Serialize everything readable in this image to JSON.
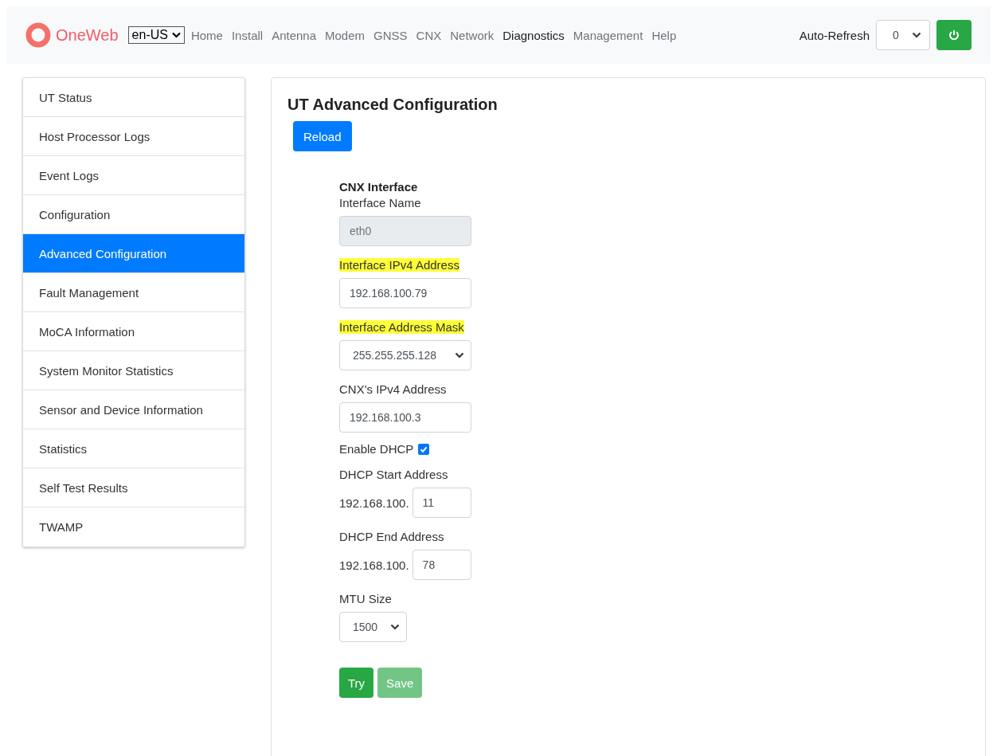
{
  "navbar": {
    "brand": "OneWeb",
    "language": "en-US",
    "links": [
      {
        "label": "Home",
        "selected": false
      },
      {
        "label": "Install",
        "selected": false
      },
      {
        "label": "Antenna",
        "selected": false
      },
      {
        "label": "Modem",
        "selected": false
      },
      {
        "label": "GNSS",
        "selected": false
      },
      {
        "label": "CNX",
        "selected": false
      },
      {
        "label": "Network",
        "selected": false
      },
      {
        "label": "Diagnostics",
        "selected": true
      },
      {
        "label": "Management",
        "selected": false
      },
      {
        "label": "Help",
        "selected": false
      }
    ],
    "auto_refresh": {
      "label": "Auto-Refresh",
      "value": "0"
    }
  },
  "sidebar": {
    "items": [
      {
        "label": "UT Status",
        "selected": false
      },
      {
        "label": "Host Processor Logs",
        "selected": false
      },
      {
        "label": "Event Logs",
        "selected": false
      },
      {
        "label": "Configuration",
        "selected": false
      },
      {
        "label": "Advanced Configuration",
        "selected": true
      },
      {
        "label": "Fault Management",
        "selected": false
      },
      {
        "label": "MoCA Information",
        "selected": false
      },
      {
        "label": "System Monitor Statistics",
        "selected": false
      },
      {
        "label": "Sensor and Device Information",
        "selected": false
      },
      {
        "label": "Statistics",
        "selected": false
      },
      {
        "label": "Self Test Results",
        "selected": false
      },
      {
        "label": "TWAMP",
        "selected": false
      }
    ]
  },
  "main": {
    "title": "UT Advanced Configuration",
    "reload_button": "Reload",
    "section": "CNX Interface",
    "fields": [
      {
        "kind": "text",
        "label": "Interface Name",
        "value": "eth0",
        "disabled": true,
        "highlighted": false
      },
      {
        "kind": "text",
        "label": "Interface IPv4 Address",
        "value": "192.168.100.79",
        "disabled": false,
        "highlighted": true
      },
      {
        "kind": "select",
        "label": "Interface Address Mask",
        "value": "255.255.255.128",
        "highlighted": true
      },
      {
        "kind": "text",
        "label": "CNX's IPv4 Address",
        "value": "192.168.100.3",
        "disabled": false,
        "highlighted": false
      },
      {
        "kind": "checkbox",
        "label": "Enable DHCP",
        "checked": true
      },
      {
        "kind": "prefixed",
        "label": "DHCP Start Address",
        "prefix": "192.168.100.",
        "value": "11",
        "highlighted": false
      },
      {
        "kind": "prefixed",
        "label": "DHCP End Address",
        "prefix": "192.168.100.",
        "value": "78",
        "highlighted": false
      },
      {
        "kind": "small-select",
        "label": "MTU Size",
        "value": "1500",
        "highlighted": false
      }
    ],
    "buttons": [
      {
        "label": "Try",
        "disabled": false
      },
      {
        "label": "Save",
        "disabled": true
      }
    ]
  }
}
